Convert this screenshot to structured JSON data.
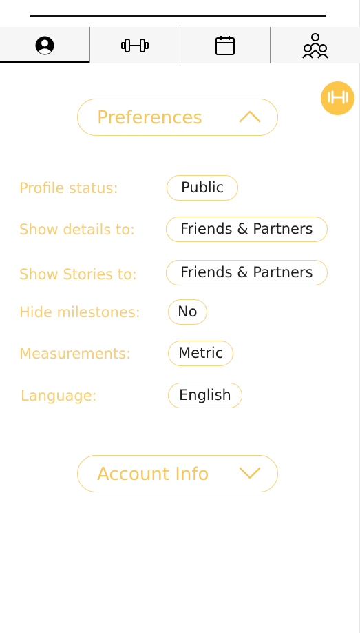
{
  "tabs": [
    {
      "name": "profile",
      "icon": "user-icon",
      "active": true
    },
    {
      "name": "workouts",
      "icon": "dumbbell-icon",
      "active": false
    },
    {
      "name": "calendar",
      "icon": "calendar-icon",
      "active": false
    },
    {
      "name": "community",
      "icon": "group-icon",
      "active": false
    }
  ],
  "fab": {
    "icon": "dumbbell-icon",
    "color": "#fcc64a"
  },
  "preferences": {
    "title": "Preferences",
    "expanded": true,
    "rows": [
      {
        "label": "Profile status:",
        "value": "Public"
      },
      {
        "label": "Show details to:",
        "value": "Friends & Partners"
      },
      {
        "label": "Show Stories to:",
        "value": "Friends & Partners"
      },
      {
        "label": "Hide milestones:",
        "value": "No"
      },
      {
        "label": "Measurements:",
        "value": "Metric"
      },
      {
        "label": "Language:",
        "value": "English"
      }
    ]
  },
  "account_info": {
    "title": "Account Info",
    "expanded": false
  },
  "colors": {
    "accent": "#f7c75c",
    "border": "#f9d37a",
    "text": "#1f1f1f"
  }
}
